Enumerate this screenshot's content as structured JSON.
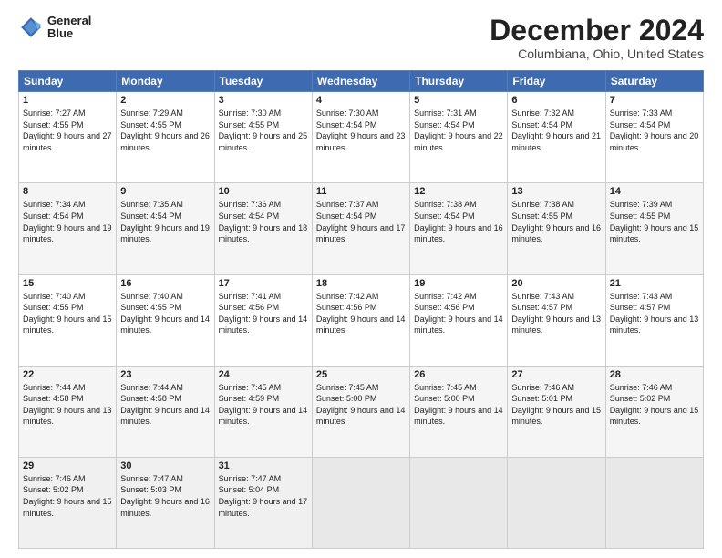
{
  "logo": {
    "line1": "General",
    "line2": "Blue"
  },
  "title": "December 2024",
  "subtitle": "Columbiana, Ohio, United States",
  "days_header": [
    "Sunday",
    "Monday",
    "Tuesday",
    "Wednesday",
    "Thursday",
    "Friday",
    "Saturday"
  ],
  "weeks": [
    [
      {
        "day": "1",
        "sunrise": "7:27 AM",
        "sunset": "4:55 PM",
        "daylight": "9 hours and 27 minutes."
      },
      {
        "day": "2",
        "sunrise": "7:29 AM",
        "sunset": "4:55 PM",
        "daylight": "9 hours and 26 minutes."
      },
      {
        "day": "3",
        "sunrise": "7:30 AM",
        "sunset": "4:55 PM",
        "daylight": "9 hours and 25 minutes."
      },
      {
        "day": "4",
        "sunrise": "7:30 AM",
        "sunset": "4:54 PM",
        "daylight": "9 hours and 23 minutes."
      },
      {
        "day": "5",
        "sunrise": "7:31 AM",
        "sunset": "4:54 PM",
        "daylight": "9 hours and 22 minutes."
      },
      {
        "day": "6",
        "sunrise": "7:32 AM",
        "sunset": "4:54 PM",
        "daylight": "9 hours and 21 minutes."
      },
      {
        "day": "7",
        "sunrise": "7:33 AM",
        "sunset": "4:54 PM",
        "daylight": "9 hours and 20 minutes."
      }
    ],
    [
      {
        "day": "8",
        "sunrise": "7:34 AM",
        "sunset": "4:54 PM",
        "daylight": "9 hours and 19 minutes."
      },
      {
        "day": "9",
        "sunrise": "7:35 AM",
        "sunset": "4:54 PM",
        "daylight": "9 hours and 19 minutes."
      },
      {
        "day": "10",
        "sunrise": "7:36 AM",
        "sunset": "4:54 PM",
        "daylight": "9 hours and 18 minutes."
      },
      {
        "day": "11",
        "sunrise": "7:37 AM",
        "sunset": "4:54 PM",
        "daylight": "9 hours and 17 minutes."
      },
      {
        "day": "12",
        "sunrise": "7:38 AM",
        "sunset": "4:54 PM",
        "daylight": "9 hours and 16 minutes."
      },
      {
        "day": "13",
        "sunrise": "7:38 AM",
        "sunset": "4:55 PM",
        "daylight": "9 hours and 16 minutes."
      },
      {
        "day": "14",
        "sunrise": "7:39 AM",
        "sunset": "4:55 PM",
        "daylight": "9 hours and 15 minutes."
      }
    ],
    [
      {
        "day": "15",
        "sunrise": "7:40 AM",
        "sunset": "4:55 PM",
        "daylight": "9 hours and 15 minutes."
      },
      {
        "day": "16",
        "sunrise": "7:40 AM",
        "sunset": "4:55 PM",
        "daylight": "9 hours and 14 minutes."
      },
      {
        "day": "17",
        "sunrise": "7:41 AM",
        "sunset": "4:56 PM",
        "daylight": "9 hours and 14 minutes."
      },
      {
        "day": "18",
        "sunrise": "7:42 AM",
        "sunset": "4:56 PM",
        "daylight": "9 hours and 14 minutes."
      },
      {
        "day": "19",
        "sunrise": "7:42 AM",
        "sunset": "4:56 PM",
        "daylight": "9 hours and 14 minutes."
      },
      {
        "day": "20",
        "sunrise": "7:43 AM",
        "sunset": "4:57 PM",
        "daylight": "9 hours and 13 minutes."
      },
      {
        "day": "21",
        "sunrise": "7:43 AM",
        "sunset": "4:57 PM",
        "daylight": "9 hours and 13 minutes."
      }
    ],
    [
      {
        "day": "22",
        "sunrise": "7:44 AM",
        "sunset": "4:58 PM",
        "daylight": "9 hours and 13 minutes."
      },
      {
        "day": "23",
        "sunrise": "7:44 AM",
        "sunset": "4:58 PM",
        "daylight": "9 hours and 14 minutes."
      },
      {
        "day": "24",
        "sunrise": "7:45 AM",
        "sunset": "4:59 PM",
        "daylight": "9 hours and 14 minutes."
      },
      {
        "day": "25",
        "sunrise": "7:45 AM",
        "sunset": "5:00 PM",
        "daylight": "9 hours and 14 minutes."
      },
      {
        "day": "26",
        "sunrise": "7:45 AM",
        "sunset": "5:00 PM",
        "daylight": "9 hours and 14 minutes."
      },
      {
        "day": "27",
        "sunrise": "7:46 AM",
        "sunset": "5:01 PM",
        "daylight": "9 hours and 15 minutes."
      },
      {
        "day": "28",
        "sunrise": "7:46 AM",
        "sunset": "5:02 PM",
        "daylight": "9 hours and 15 minutes."
      }
    ],
    [
      {
        "day": "29",
        "sunrise": "7:46 AM",
        "sunset": "5:02 PM",
        "daylight": "9 hours and 15 minutes."
      },
      {
        "day": "30",
        "sunrise": "7:47 AM",
        "sunset": "5:03 PM",
        "daylight": "9 hours and 16 minutes."
      },
      {
        "day": "31",
        "sunrise": "7:47 AM",
        "sunset": "5:04 PM",
        "daylight": "9 hours and 17 minutes."
      },
      null,
      null,
      null,
      null
    ]
  ],
  "labels": {
    "sunrise": "Sunrise:",
    "sunset": "Sunset:",
    "daylight": "Daylight:"
  }
}
